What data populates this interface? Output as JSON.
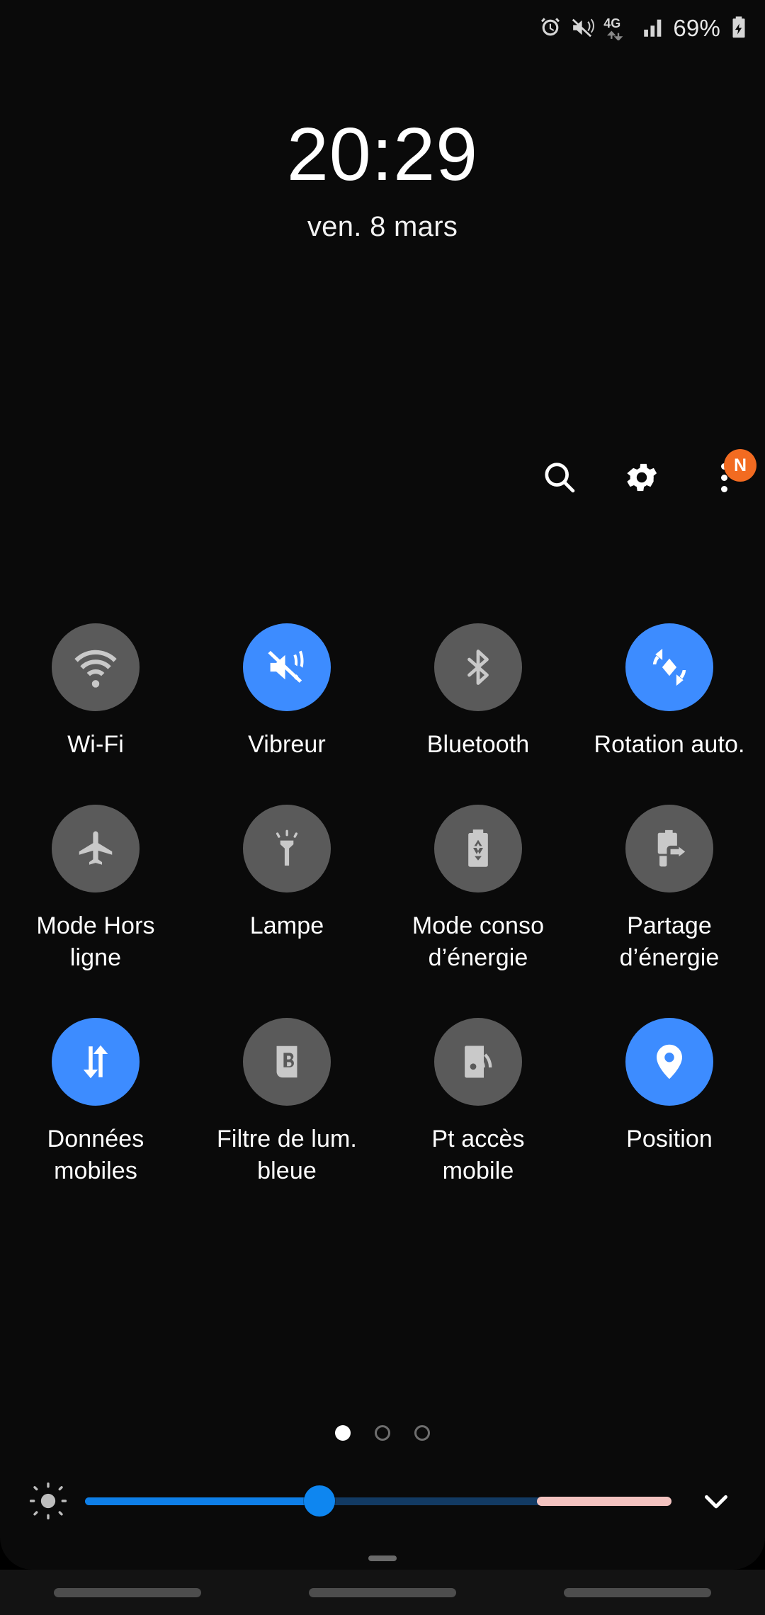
{
  "status_bar": {
    "icons": [
      "alarm-icon",
      "vibrate-mute-icon",
      "network-4g-icon",
      "signal-bars-icon"
    ],
    "network_label": "4G",
    "battery_percent": "69%",
    "battery_state": "charging"
  },
  "clock": {
    "time": "20:29",
    "date": "ven. 8 mars"
  },
  "header_actions": [
    {
      "name": "search-button",
      "icon": "search-icon",
      "label": ""
    },
    {
      "name": "settings-button",
      "icon": "gear-icon",
      "label": ""
    },
    {
      "name": "more-options-button",
      "icon": "three-dots-icon",
      "badge": "N"
    }
  ],
  "tiles": [
    {
      "label": "Wi-Fi",
      "icon": "wifi-icon",
      "state": "off"
    },
    {
      "label": "Vibreur",
      "icon": "vibrate-icon",
      "state": "on"
    },
    {
      "label": "Bluetooth",
      "icon": "bluetooth-icon",
      "state": "off"
    },
    {
      "label": "Rotation auto.",
      "icon": "auto-rotate-icon",
      "state": "on"
    },
    {
      "label": "Mode Hors ligne",
      "icon": "airplane-icon",
      "state": "off"
    },
    {
      "label": "Lampe",
      "icon": "flashlight-icon",
      "state": "off"
    },
    {
      "label": "Mode conso d’énergie",
      "icon": "power-saving-icon",
      "state": "off"
    },
    {
      "label": "Partage d’énergie",
      "icon": "battery-share-icon",
      "state": "off"
    },
    {
      "label": "Données mobiles",
      "icon": "mobile-data-icon",
      "state": "on"
    },
    {
      "label": "Filtre de lum. bleue",
      "icon": "blue-light-filter-icon",
      "state": "off"
    },
    {
      "label": "Pt accès mobile",
      "icon": "hotspot-icon",
      "state": "off"
    },
    {
      "label": "Position",
      "icon": "location-pin-icon",
      "state": "on"
    }
  ],
  "pagination": {
    "total_pages": 3,
    "current_page": 1
  },
  "brightness": {
    "icon": "brightness-sun-icon",
    "value_percent": 40,
    "expand_icon": "chevron-down-icon"
  },
  "colors": {
    "tile_on": "#3d8cff",
    "tile_off": "#5a5a5a",
    "badge": "#f26b21",
    "slider_fill": "#0e7fe8",
    "slider_track": "#123a63",
    "slider_end": "#f3c3c0",
    "background": "#0a0a0a"
  },
  "navigation_bar": {
    "pills": [
      "recents-pill",
      "home-pill",
      "back-pill"
    ]
  }
}
